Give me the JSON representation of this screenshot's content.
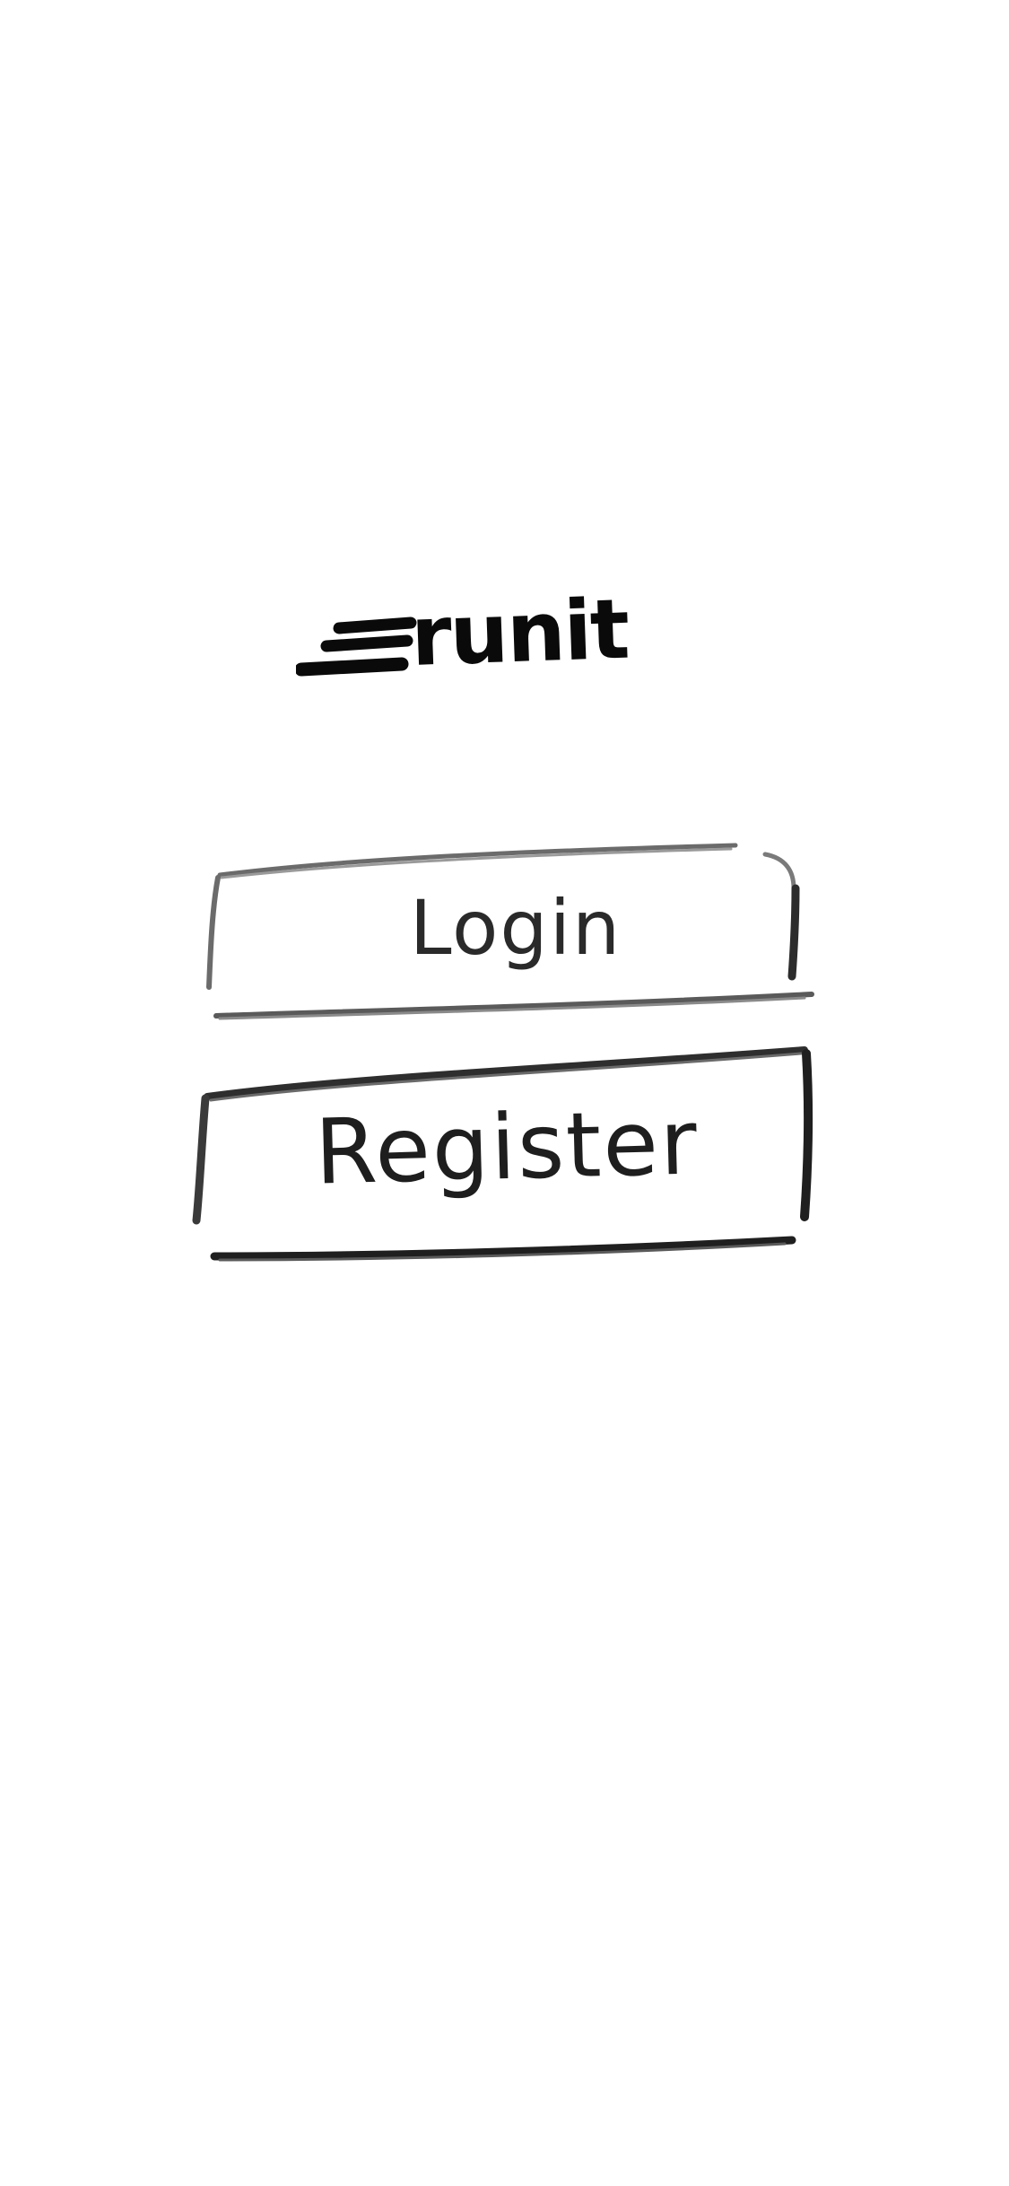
{
  "app": {
    "brand": "runit",
    "logo_icon": "speed-lines-icon"
  },
  "actions": {
    "login_label": "Login",
    "register_label": "Register"
  },
  "colors": {
    "background": "#ffffff",
    "ink": "#0a0a0a",
    "pencil": "#2a2a2a"
  }
}
